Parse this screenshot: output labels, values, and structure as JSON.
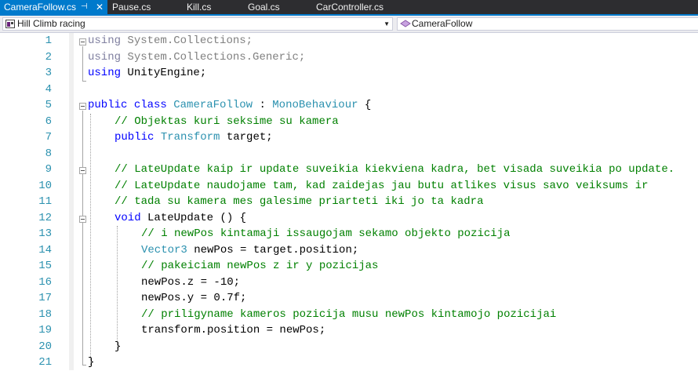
{
  "tabs": [
    {
      "label": "CameraFollow.cs",
      "active": true,
      "pin_icon": "pin-icon",
      "close_icon": "close-icon"
    },
    {
      "label": "Pause.cs",
      "active": false
    },
    {
      "label": "Kill.cs",
      "active": false
    },
    {
      "label": "Goal.cs",
      "active": false
    },
    {
      "label": "CarController.cs",
      "active": false
    }
  ],
  "nav": {
    "project": "Hill Climb racing",
    "class": "CameraFollow"
  },
  "colors": {
    "accent": "#007acc",
    "keyword": "#0000ff",
    "type": "#2b91af",
    "comment": "#008000",
    "line_number": "#2b91af",
    "unused_using": "#808080"
  },
  "editor": {
    "line_numbers": [
      "1",
      "2",
      "3",
      "4",
      "5",
      "6",
      "7",
      "8",
      "9",
      "10",
      "11",
      "12",
      "13",
      "14",
      "15",
      "16",
      "17",
      "18",
      "19",
      "20",
      "21"
    ],
    "tokens": {
      "l1_kw": "using",
      "l1_rest": " System.Collections;",
      "l2_kw": "using",
      "l2_rest": " System.Collections.Generic;",
      "l3_kw": "using",
      "l3_rest": " UnityEngine;",
      "l5_kw1": "public",
      "l5_kw2": " class ",
      "l5_type": "CameraFollow",
      "l5_mid": " : ",
      "l5_base": "MonoBehaviour",
      "l5_end": " {",
      "l6_comment": "// Objektas kuri seksime su kamera",
      "l7_kw": "public",
      "l7_sp": " ",
      "l7_type": "Transform",
      "l7_rest": " target;",
      "l9_comment": "// LateUpdate kaip ir update suveikia kiekviena kadra, bet visada suveikia po update.",
      "l10_comment": "// LateUpdate naudojame tam, kad zaidejas jau butu atlikes visus savo veiksums ir",
      "l11_comment": "// tada su kamera mes galesime priarteti iki jo ta kadra",
      "l12_kw": "void",
      "l12_rest": " LateUpdate () {",
      "l13_comment": "// i newPos kintamaji issaugojam sekamo objekto pozicija",
      "l14_type": "Vector3",
      "l14_rest": " newPos = target.position;",
      "l15_comment": "// pakeiciam newPos z ir y pozicijas",
      "l16_code": "newPos.z = -10;",
      "l17_code": "newPos.y = 0.7f;",
      "l18_comment": "// priligyname kameros pozicija musu newPos kintamojo pozicijai",
      "l19_code": "transform.position = newPos;",
      "l20_code": "}",
      "l21_code": "}"
    }
  }
}
